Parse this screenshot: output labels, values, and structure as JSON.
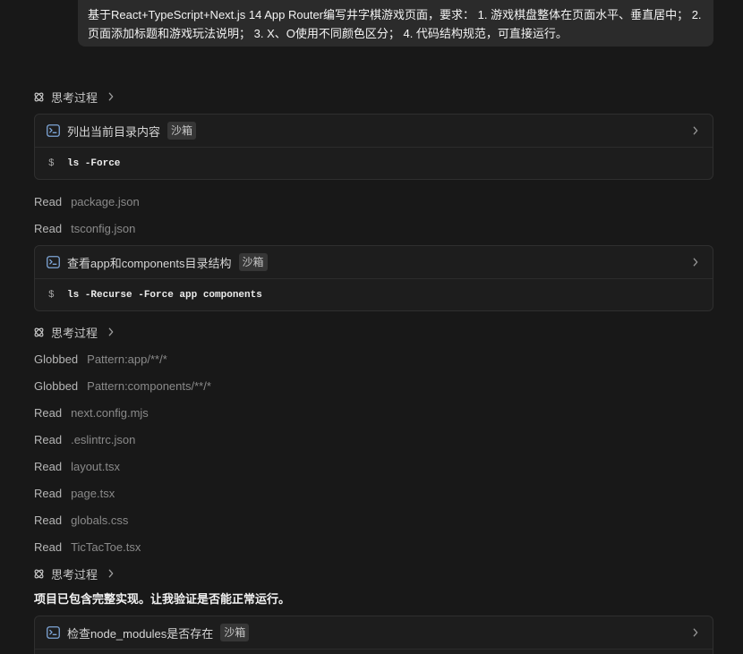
{
  "user_message": {
    "lines": [
      "基于React+TypeScript+Next.js 14 App Router编写井字棋游戏页面，要求： 1. 游戏棋盘整体在页面水平、垂直居中； 2.",
      "页面添加标题和游戏玩法说明； 3. X、O使用不同颜色区分； 4. 代码结构规范，可直接运行。"
    ]
  },
  "icons": {
    "thinking": "atom-icon",
    "expand": "chevron-right-icon",
    "terminal": "terminal-icon"
  },
  "colors": {
    "background": "#181818",
    "bubble": "#2b2b2b",
    "card": "#1d1d1d",
    "card_border": "#2f2f2f",
    "terminal_icon": "#7ea6d8",
    "badge": "#363636"
  },
  "timeline": [
    {
      "label": "思考过程"
    },
    {
      "title": "列出当前目录内容",
      "badge": "沙箱",
      "prompt": "$",
      "command": "ls -Force"
    },
    {
      "verb": "Read",
      "target": "package.json"
    },
    {
      "verb": "Read",
      "target": "tsconfig.json"
    },
    {
      "title": "查看app和components目录结构",
      "badge": "沙箱",
      "prompt": "$",
      "command": "ls -Recurse -Force app components"
    },
    {
      "label": "思考过程"
    },
    {
      "verb": "Globbed",
      "target": "Pattern:app/**/*"
    },
    {
      "verb": "Globbed",
      "target": "Pattern:components/**/*"
    },
    {
      "verb": "Read",
      "target": "next.config.mjs"
    },
    {
      "verb": "Read",
      "target": ".eslintrc.json"
    },
    {
      "verb": "Read",
      "target": "layout.tsx"
    },
    {
      "verb": "Read",
      "target": "page.tsx"
    },
    {
      "verb": "Read",
      "target": "globals.css"
    },
    {
      "verb": "Read",
      "target": "TicTacToe.tsx"
    },
    {
      "label": "思考过程"
    },
    {
      "text": "项目已包含完整实现。让我验证是否能正常运行。"
    },
    {
      "title": "检查node_modules是否存在",
      "badge": "沙箱"
    }
  ]
}
